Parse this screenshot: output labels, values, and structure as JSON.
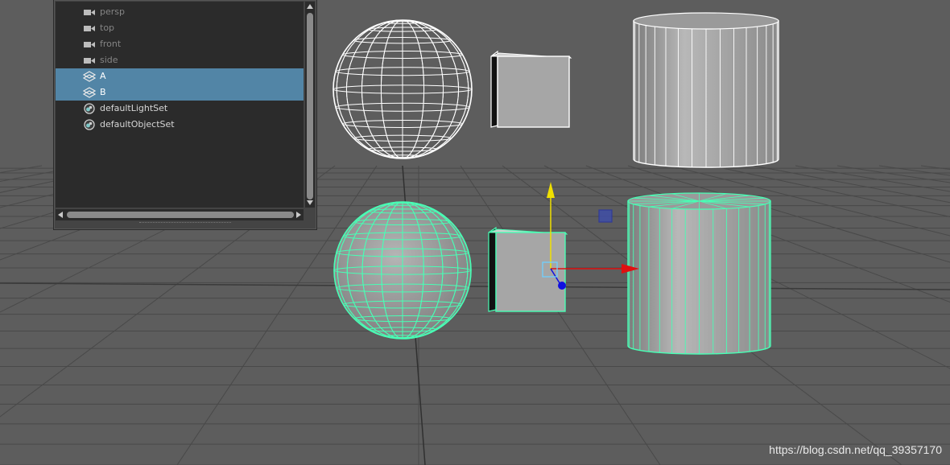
{
  "outliner": {
    "items": [
      {
        "label": "persp",
        "icon": "camera-icon",
        "state": "dim"
      },
      {
        "label": "top",
        "icon": "camera-icon",
        "state": "dim"
      },
      {
        "label": "front",
        "icon": "camera-icon",
        "state": "dim"
      },
      {
        "label": "side",
        "icon": "camera-icon",
        "state": "dim"
      },
      {
        "label": "A",
        "icon": "group-icon",
        "state": "selected"
      },
      {
        "label": "B",
        "icon": "group-icon",
        "state": "selected"
      },
      {
        "label": "defaultLightSet",
        "icon": "set-icon",
        "state": "normal"
      },
      {
        "label": "defaultObjectSet",
        "icon": "set-icon",
        "state": "normal"
      }
    ]
  },
  "colors": {
    "viewport_bg": "#5d5d5d",
    "selection_highlight": "#5285a6",
    "wireframe_selected": "#48ffb5",
    "wireframe_unselected": "#ffffff",
    "manipulator_x": "#e01010",
    "manipulator_y": "#f0e000",
    "manipulator_z": "#1010e0"
  },
  "watermark": "https://blog.csdn.net/qq_39357170"
}
